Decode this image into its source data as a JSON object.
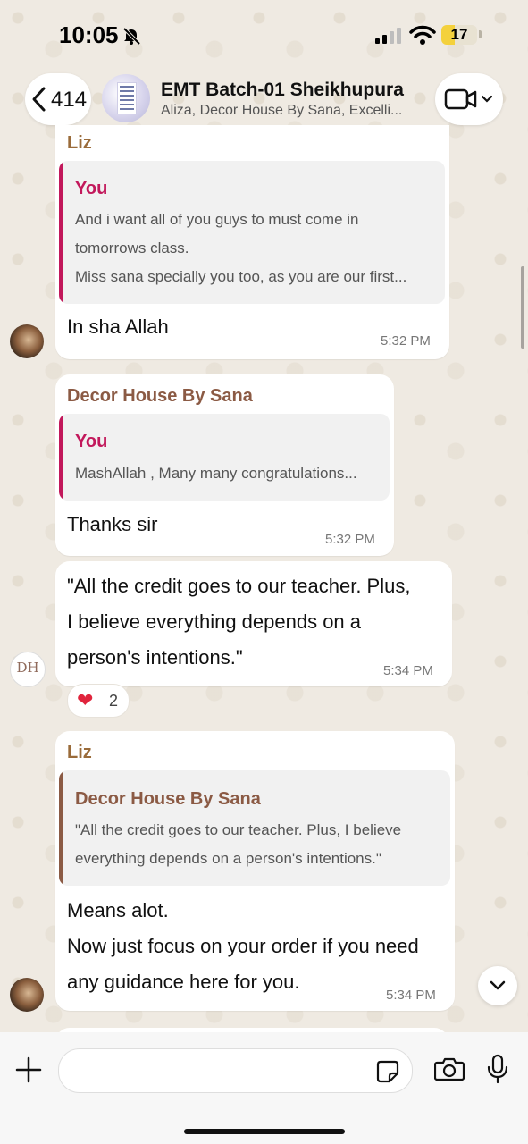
{
  "status_bar": {
    "time": "10:05",
    "battery": "17",
    "battery_level": 0.17
  },
  "header": {
    "back_count": "414",
    "title": "EMT Batch-01 Sheikhupura",
    "subtitle": "Aliza, Decor House By Sana, Excelli..."
  },
  "colors": {
    "liz": "#9a6b3a",
    "decor": "#8b5a44",
    "you": "#c2185b",
    "bubble": "#ffffff",
    "background": "#efeae2"
  },
  "messages": [
    {
      "sender": "Liz",
      "quote": {
        "author": "You",
        "lines": [
          "And i want all of you guys to must come in",
          "tomorrows class.",
          "Miss sana specially you too, as you are our first..."
        ]
      },
      "lines": [
        "In sha Allah"
      ],
      "time": "5:32 PM"
    },
    {
      "sender": "Decor House By Sana",
      "quote": {
        "author": "You",
        "lines": [
          "MashAllah , Many many congratulations..."
        ]
      },
      "lines": [
        "Thanks sir"
      ],
      "time": "5:32 PM"
    },
    {
      "sender": "",
      "lines": [
        "\"All the credit goes to our teacher. Plus,",
        "I believe everything depends on a",
        "person's intentions.\""
      ],
      "time": "5:34 PM",
      "avatar_text": "DH",
      "reaction": {
        "emoji": "❤",
        "count": "2"
      }
    },
    {
      "sender": "Liz",
      "quote": {
        "author": "Decor House By Sana",
        "lines": [
          "\"All the credit goes to our teacher. Plus, I believe",
          "everything depends on a person's intentions.\""
        ]
      },
      "lines": [
        "Means alot.",
        "Now just focus on your order if you need",
        "any guidance here for you."
      ],
      "time": "5:34 PM"
    }
  ],
  "composer": {
    "placeholder": "",
    "value": ""
  },
  "icons": [
    "bell-slash-icon",
    "signal-icon",
    "wifi-icon",
    "chevron-left-icon",
    "video-camera-icon",
    "chevron-down-icon",
    "plus-icon",
    "sticker-icon",
    "camera-icon",
    "microphone-icon",
    "heart-icon"
  ]
}
